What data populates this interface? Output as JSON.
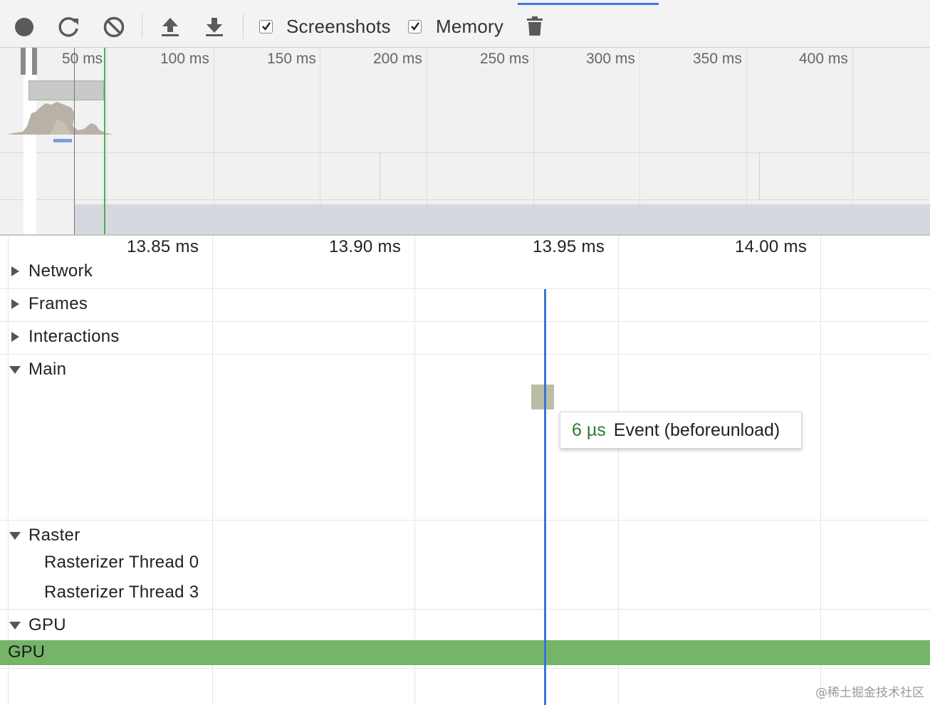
{
  "toolbar": {
    "record_icon": "record-icon",
    "reload_icon": "reload-icon",
    "clear_icon": "clear-icon",
    "upload_icon": "upload-icon",
    "download_icon": "download-icon",
    "trash_icon": "trash-icon",
    "screenshots_label": "Screenshots",
    "screenshots_checked": true,
    "memory_label": "Memory",
    "memory_checked": true,
    "accent_color": "#3b78e7"
  },
  "overview": {
    "ticks": [
      "50 ms",
      "100 ms",
      "150 ms",
      "200 ms",
      "250 ms",
      "300 ms",
      "350 ms",
      "400 ms"
    ]
  },
  "timeline": {
    "ticks": [
      "13.85 ms",
      "13.90 ms",
      "13.95 ms",
      "14.00 ms"
    ]
  },
  "tracks": {
    "network": "Network",
    "frames": "Frames",
    "interactions": "Interactions",
    "main": "Main",
    "raster": "Raster",
    "raster_threads": [
      "Rasterizer Thread 0",
      "Rasterizer Thread 3"
    ],
    "gpu": "GPU",
    "gpu_bar_label": "GPU",
    "gpu_color": "#74b56a"
  },
  "tooltip": {
    "duration": "6 µs",
    "event": "Event (beforeunload)"
  },
  "watermark": "@稀土掘金技术社区"
}
